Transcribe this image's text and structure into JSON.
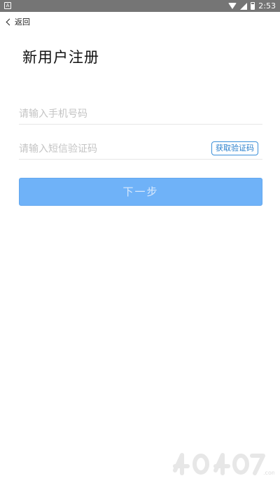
{
  "status_bar": {
    "time": "2:53",
    "left_icon": "android-notification-icon",
    "icons": [
      "wifi-icon",
      "signal-icon",
      "battery-icon"
    ]
  },
  "nav": {
    "back_label": "返回"
  },
  "page": {
    "title": "新用户注册"
  },
  "form": {
    "phone": {
      "value": "",
      "placeholder": "请输入手机号码"
    },
    "code": {
      "value": "",
      "placeholder": "请输入短信验证码"
    },
    "get_code_label": "获取验证码",
    "next_label": "下一步"
  },
  "colors": {
    "accent": "#6fb2f8",
    "link": "#2a7fcc",
    "status_bar": "#757575"
  }
}
